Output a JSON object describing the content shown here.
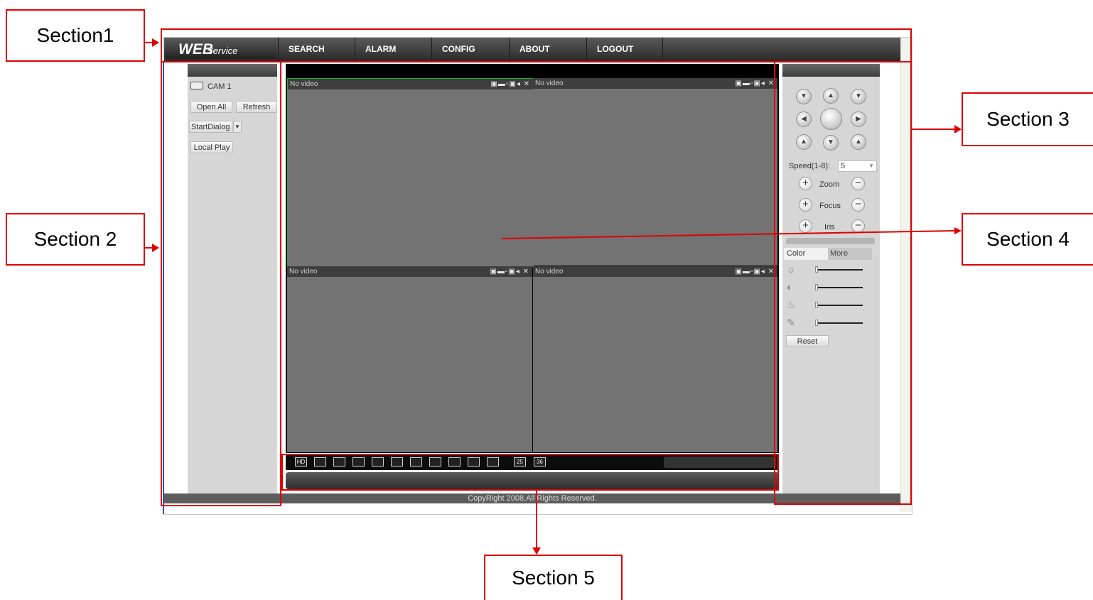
{
  "callouts": {
    "section1": "Section1",
    "section2": "Section 2",
    "section3": "Section 3",
    "section4": "Section 4",
    "section5": "Section 5"
  },
  "header": {
    "logo_main": "WEB",
    "logo_sub": "Service",
    "nav": [
      "SEARCH",
      "ALARM",
      "CONFIG",
      "ABOUT",
      "LOGOUT"
    ]
  },
  "sidebar": {
    "camera": "CAM 1",
    "open_all": "Open All",
    "refresh": "Refresh",
    "start_dialog": "StartDialog",
    "local_play": "Local Play"
  },
  "video": {
    "cells": [
      {
        "label": "No video",
        "selected": true
      },
      {
        "label": "No video",
        "selected": false
      },
      {
        "label": "No video",
        "selected": false
      },
      {
        "label": "No video",
        "selected": false
      }
    ]
  },
  "toolbar": {
    "layout_buttons": [
      "HD",
      "",
      "",
      "",
      "",
      "",
      "",
      "",
      "",
      "",
      "",
      "25",
      "36"
    ]
  },
  "ptz": {
    "speed_label": "Speed(1-8):",
    "speed_value": "5",
    "zoom": "Zoom",
    "focus": "Focus",
    "iris": "Iris",
    "tabs": [
      "Color",
      "More"
    ],
    "reset": "Reset"
  },
  "footer": {
    "copyright": "CopyRight 2008,All Rights Reserved."
  },
  "colors": {
    "accent": "#e00000",
    "panel": "#d6d6d6",
    "video_bg": "#737373",
    "selected_border": "#22aa22"
  }
}
